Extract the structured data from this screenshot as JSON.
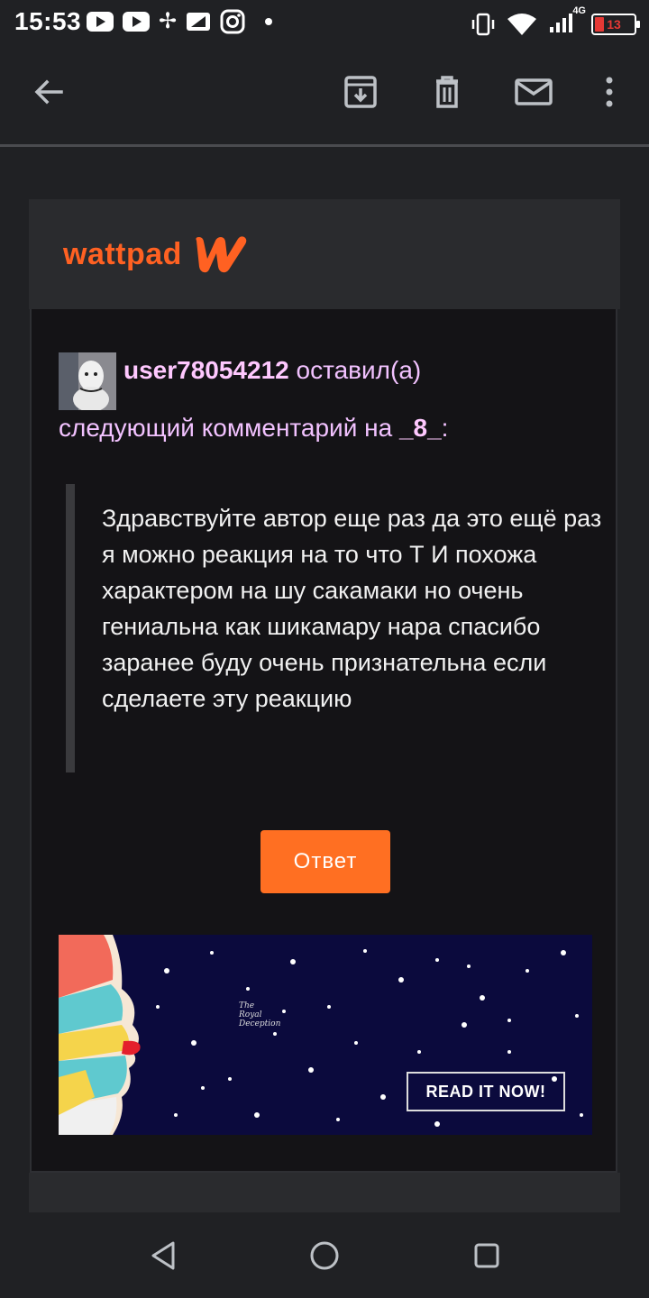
{
  "status_bar": {
    "time": "15:53",
    "network": "4G",
    "battery": "13"
  },
  "email": {
    "brand": "wattpad",
    "username": "user78054212",
    "action_text": " оставил(а)",
    "line2_prefix": "следующий комментарий на ",
    "story_name": "_8_",
    "line2_suffix": ":",
    "comment": "Здравствуйте автор еще раз да это ещё раз я можно реакция на то что Т И похожа характером на шу сакамаки но очень гениальна как шикамару нара спасибо заранее буду очень признательна если сделаете эту реакцию",
    "reply_label": "Ответ",
    "banner": {
      "cta": "READ IT NOW!",
      "title_line1": "The",
      "title_line2": "Royal",
      "title_line3": "Deception"
    }
  },
  "icons": {
    "back": "arrow-back-icon",
    "archive": "archive-icon",
    "delete": "trash-icon",
    "mail": "mail-icon",
    "more": "more-vert-icon"
  },
  "colors": {
    "accent": "#ff6122",
    "button": "#ff6f22",
    "username": "#ffc8ff",
    "background": "#202124"
  }
}
